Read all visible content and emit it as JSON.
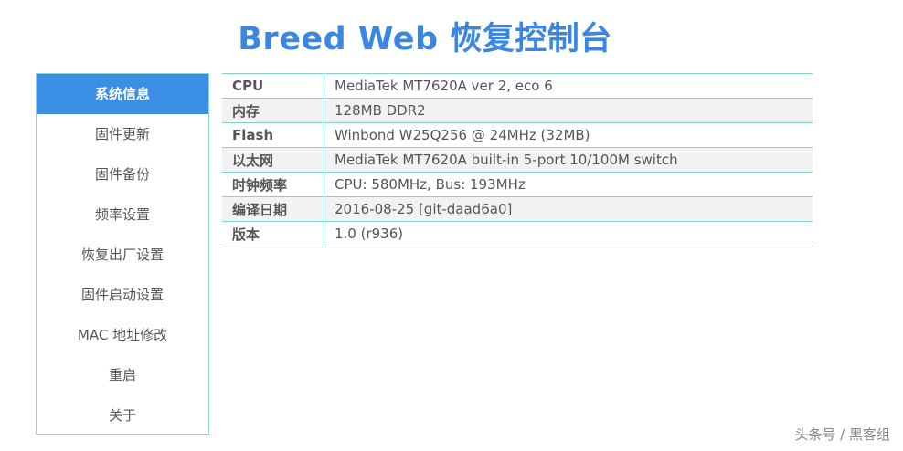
{
  "header": {
    "title": "Breed Web 恢复控制台"
  },
  "sidebar": {
    "items": [
      {
        "label": "系统信息",
        "active": true
      },
      {
        "label": "固件更新",
        "active": false
      },
      {
        "label": "固件备份",
        "active": false
      },
      {
        "label": "频率设置",
        "active": false
      },
      {
        "label": "恢复出厂设置",
        "active": false
      },
      {
        "label": "固件启动设置",
        "active": false
      },
      {
        "label": "MAC 地址修改",
        "active": false
      },
      {
        "label": "重启",
        "active": false
      },
      {
        "label": "关于",
        "active": false
      }
    ]
  },
  "info": {
    "rows": [
      {
        "key": "CPU",
        "value": "MediaTek MT7620A ver 2, eco 6"
      },
      {
        "key": "内存",
        "value": "128MB DDR2"
      },
      {
        "key": "Flash",
        "value": "Winbond W25Q256 @ 24MHz (32MB)"
      },
      {
        "key": "以太网",
        "value": "MediaTek MT7620A built-in 5-port 10/100M switch"
      },
      {
        "key": "时钟频率",
        "value": "CPU: 580MHz, Bus: 193MHz"
      },
      {
        "key": "编译日期",
        "value": "2016-08-25 [git-daad6a0]"
      },
      {
        "key": "版本",
        "value": "1.0 (r936)"
      }
    ]
  },
  "watermark": {
    "text": "头条号 / 黑客组"
  },
  "colors": {
    "accent": "#3a8ee6",
    "title": "#3b86e0",
    "border": "#7fd6cf"
  }
}
